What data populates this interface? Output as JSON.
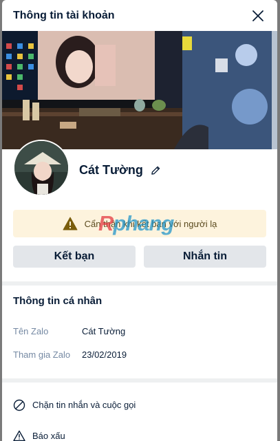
{
  "header": {
    "title": "Thông tin tài khoản"
  },
  "profile": {
    "name": "Cát Tường"
  },
  "warning": {
    "text": "Cẩn thận khi kết bạn với người lạ",
    "icon": "warning-icon"
  },
  "watermark": {
    "part1": "R",
    "part2": "phang"
  },
  "actions": {
    "add_friend": "Kết bạn",
    "message": "Nhắn tin"
  },
  "personal_info": {
    "title": "Thông tin cá nhân",
    "rows": [
      {
        "label": "Tên Zalo",
        "value": "Cát Tường"
      },
      {
        "label": "Tham gia Zalo",
        "value": "23/02/2019"
      }
    ]
  },
  "menu": {
    "block": "Chặn tin nhắn và cuộc gọi",
    "report": "Báo xấu"
  },
  "colors": {
    "accent": "#081c36",
    "warning_bg": "#fdf3dd",
    "button_bg": "#e3e6ea"
  }
}
